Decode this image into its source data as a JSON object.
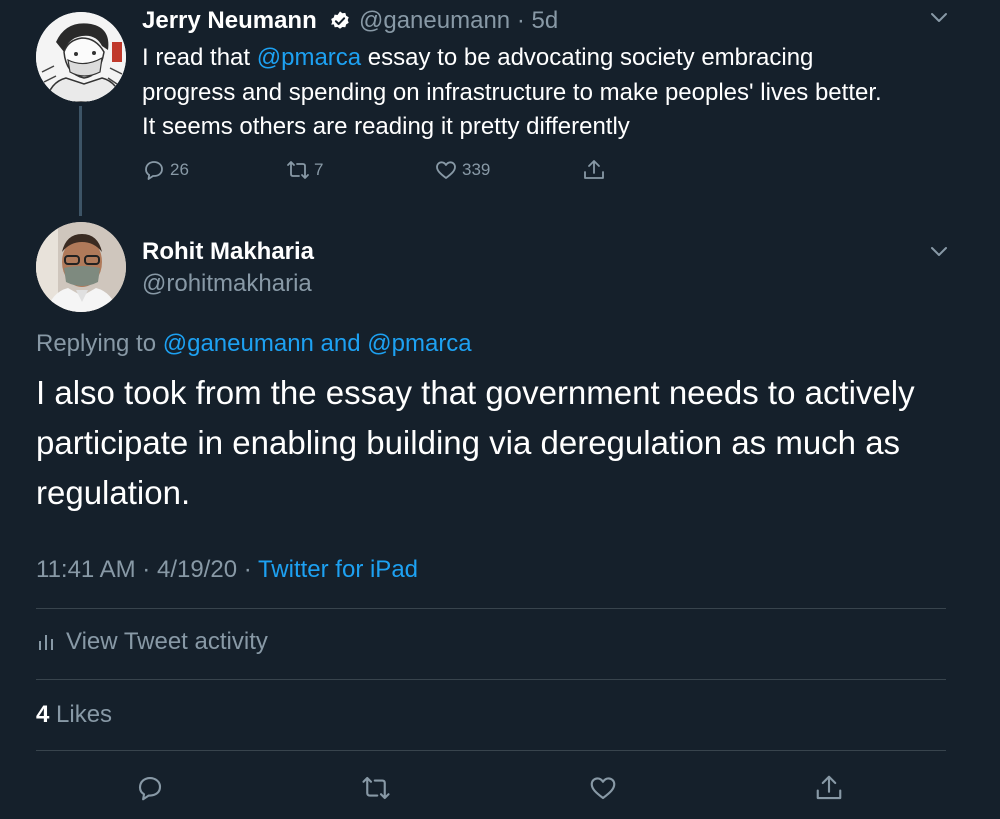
{
  "parent_tweet": {
    "author_name": "Jerry Neumann",
    "handle": "@ganeumann",
    "separator": "·",
    "time_ago": "5d",
    "text_line1_pre": "I read that ",
    "text_line1_mention": "@pmarca",
    "text_line1_post": " essay to be advocating society embracing",
    "text_line2": "progress and spending on infrastructure to make peoples' lives better.",
    "text_line3": "It seems others are reading it pretty differently",
    "reply_count": "26",
    "retweet_count": "7",
    "like_count": "339"
  },
  "reply_tweet": {
    "author_name": "Rohit Makharia",
    "handle": "@rohitmakharia",
    "replying_label": "Replying to",
    "replying_targets": "@ganeumann and @pmarca",
    "text": "I also took from the essay that government needs to actively participate in enabling building via deregulation as much as regulation.",
    "time": "11:41 AM",
    "date": "4/19/20",
    "meta_sep": "·",
    "source": "Twitter for iPad",
    "view_activity_label": "View Tweet activity",
    "likes_count": "4",
    "likes_label": "Likes"
  },
  "colors": {
    "background": "#15202b",
    "accent": "#1da1f2",
    "muted": "#8899a6",
    "divider": "#38444d"
  },
  "icons": [
    "verified-icon",
    "chevron-down-icon",
    "reply-icon",
    "retweet-icon",
    "like-icon",
    "share-icon",
    "activity-bars-icon"
  ]
}
